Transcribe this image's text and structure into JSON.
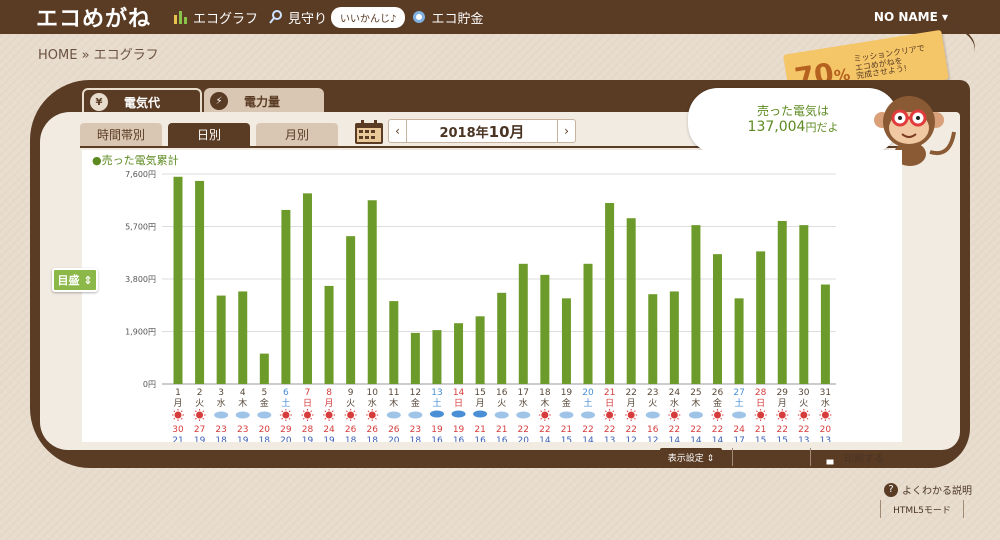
{
  "header": {
    "logo": "エコめがね",
    "nav": [
      {
        "label": "エコグラフ",
        "icon": "bar-chart-icon"
      },
      {
        "label": "見守り",
        "icon": "search-magnifier-icon"
      },
      {
        "label": "エコ貯金",
        "icon": "piggy-bank-icon"
      }
    ],
    "bubble": "いいかんじ♪",
    "user": "NO NAME ▾"
  },
  "breadcrumb": "HOME » エコグラフ",
  "mission": {
    "percent": "70",
    "unit": "%",
    "line1": "ミッションクリアで",
    "line2": "エコめがねを",
    "line3": "完成させよう!"
  },
  "tabs": {
    "cost": "電気代",
    "cost_icon": "¥",
    "power": "電力量",
    "power_icon": "⚡"
  },
  "subtabs": {
    "hourly": "時間帯別",
    "daily": "日別",
    "monthly": "月別"
  },
  "month_nav": {
    "prev": "‹",
    "next": "›",
    "year": "2018年",
    "month": "10月"
  },
  "speech": {
    "line1": "売った電気は",
    "amount": "137,004",
    "suffix": "円だよ"
  },
  "scale_button": "目盛 ⇕",
  "footer": {
    "display_settings": "表示設定 ⇕",
    "print": "印刷する",
    "help": "よくわかる説明",
    "help_icon": "?",
    "html5": "HTML5モード"
  },
  "colors": {
    "bar": "#6d9b2b",
    "header": "#5a3b24",
    "saturday": "#4a8fd6",
    "sunday": "#d63c3c",
    "weekday": "#5a4a3a"
  },
  "chart_data": {
    "type": "bar",
    "title": "●売った電気累計",
    "ylim": [
      0,
      7600
    ],
    "yticks": [
      0,
      1900,
      3800,
      5700,
      7600
    ],
    "ytick_labels": [
      "0円",
      "1,900円",
      "3,800円",
      "5,700円",
      "7,600円"
    ],
    "grid": true,
    "categories": [
      "1",
      "2",
      "3",
      "4",
      "5",
      "6",
      "7",
      "8",
      "9",
      "10",
      "11",
      "12",
      "13",
      "14",
      "15",
      "16",
      "17",
      "18",
      "19",
      "20",
      "21",
      "22",
      "23",
      "24",
      "25",
      "26",
      "27",
      "28",
      "29",
      "30",
      "31"
    ],
    "weekdays": [
      "月",
      "火",
      "水",
      "木",
      "金",
      "土",
      "日",
      "月",
      "火",
      "水",
      "木",
      "金",
      "土",
      "日",
      "月",
      "火",
      "水",
      "木",
      "金",
      "土",
      "日",
      "月",
      "火",
      "水",
      "木",
      "金",
      "土",
      "日",
      "月",
      "火",
      "水"
    ],
    "day_colors": [
      "w",
      "w",
      "w",
      "w",
      "w",
      "sat",
      "sun",
      "sun",
      "w",
      "w",
      "w",
      "w",
      "sat",
      "sun",
      "w",
      "w",
      "w",
      "w",
      "w",
      "sat",
      "sun",
      "w",
      "w",
      "w",
      "w",
      "w",
      "sat",
      "sun",
      "w",
      "w",
      "w"
    ],
    "weather": [
      "sun",
      "sun",
      "cloud",
      "cloud",
      "cloud",
      "sun",
      "sun",
      "sun",
      "sun",
      "sun",
      "cloud",
      "cloud",
      "rain",
      "rain",
      "rain",
      "cloud",
      "cloud",
      "sun",
      "cloud",
      "cloud",
      "sun",
      "sun",
      "cloud",
      "sun",
      "cloud",
      "sun",
      "cloud",
      "sun",
      "sun",
      "sun",
      "sun"
    ],
    "high_temps": [
      30,
      27,
      23,
      23,
      20,
      29,
      28,
      24,
      26,
      26,
      26,
      23,
      19,
      19,
      21,
      21,
      22,
      22,
      21,
      22,
      22,
      22,
      16,
      22,
      22,
      22,
      24,
      21,
      22,
      22,
      20
    ],
    "low_temps": [
      21,
      19,
      18,
      19,
      18,
      20,
      19,
      19,
      18,
      18,
      20,
      18,
      16,
      16,
      16,
      16,
      20,
      14,
      15,
      14,
      13,
      12,
      12,
      14,
      14,
      14,
      17,
      15,
      15,
      13,
      13
    ],
    "values": [
      7500,
      7350,
      3200,
      3350,
      1100,
      6300,
      6900,
      3550,
      5350,
      6650,
      3000,
      1850,
      1950,
      2200,
      2450,
      3300,
      4350,
      3950,
      3100,
      4350,
      6550,
      6000,
      3250,
      3350,
      5750,
      4700,
      3100,
      4800,
      5900,
      5750,
      3600
    ]
  }
}
